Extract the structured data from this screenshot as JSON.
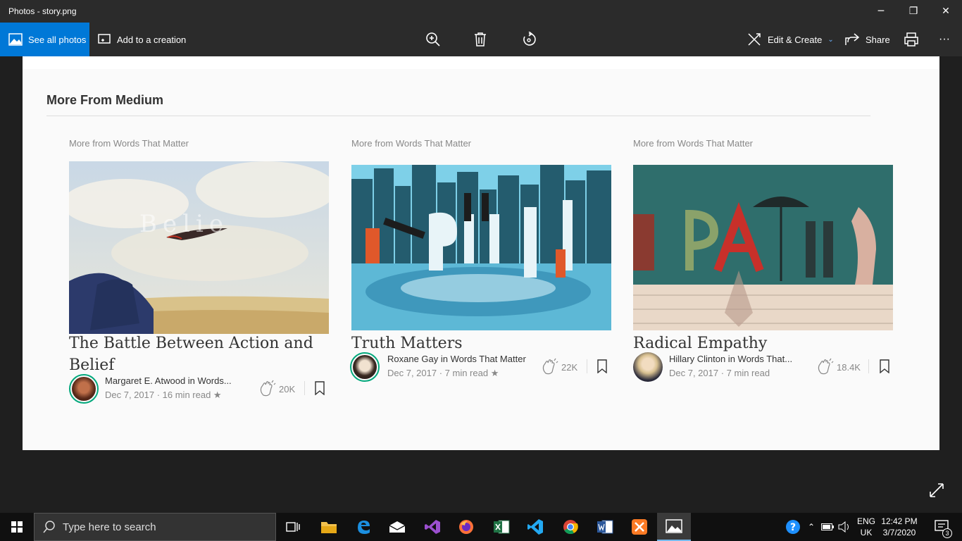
{
  "window": {
    "title": "Photos - story.png",
    "minimize_glyph": "─",
    "maximize_glyph": "❐",
    "close_glyph": "✕"
  },
  "toolbar": {
    "see_all_label": "See all photos",
    "add_creation_label": "Add to a creation",
    "zoom_icon": "zoom-in-icon",
    "delete_icon": "trash-icon",
    "rotate_icon": "rotate-icon",
    "edit_create_label": "Edit & Create",
    "share_label": "Share",
    "print_icon": "print-icon",
    "more_label": "···",
    "accent": "#0078d7"
  },
  "page": {
    "section_title": "More From Medium",
    "cards": [
      {
        "kicker": "More from Words That Matter",
        "headline": "The Battle Between Action and Belief",
        "author": "Margaret E. Atwood in Words...",
        "date": "Dec 7, 2017 · 16 min read ★",
        "claps": "20K"
      },
      {
        "kicker": "More from Words That Matter",
        "headline": "Truth Matters",
        "author": "Roxane Gay in Words That Matter",
        "date": "Dec 7, 2017 · 7 min read ★",
        "claps": "22K"
      },
      {
        "kicker": "More from Words That Matter",
        "headline": "Radical Empathy",
        "author": "Hillary Clinton in Words That...",
        "date": "Dec 7, 2017 · 7 min read",
        "claps": "18.4K"
      }
    ],
    "image1_overlay_text": "Belie"
  },
  "taskbar": {
    "search_placeholder": "Type here to search",
    "lang_line1": "ENG",
    "lang_line2": "UK",
    "time": "12:42 PM",
    "date": "3/7/2020",
    "notification_count": "3"
  }
}
